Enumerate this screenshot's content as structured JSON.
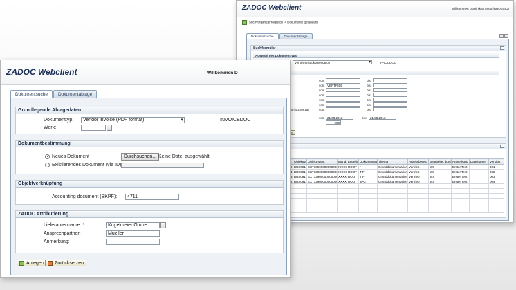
{
  "back": {
    "title": "ZADOC Webclient",
    "welcome": "Willkommen Dominik Brossio (BROSSIO)",
    "status_message": "Suchvorgang erfolgreich (4 Dokumente gefunden)",
    "tabs": [
      "Dokumentsuche",
      "Dokumentablage"
    ],
    "suchformular": {
      "header": "Suchformular",
      "auswahl_header": "Auswahl des Dokumenttyps",
      "doctype_label": "Dokumenttyp:",
      "doctype_value": "Verfahrensdokumentation",
      "doctype_code": "PROCDOC",
      "criteria_header": "Suchkriterien",
      "criteria": [
        {
          "label": "Thema",
          "from": "",
          "to": ""
        },
        {
          "label": "Arbeitsbereich",
          "from": "VERTRIEB",
          "to": ""
        },
        {
          "label": "Bearbeitet durch",
          "from": "",
          "to": ""
        },
        {
          "label": "Anmerkung",
          "from": "",
          "to": ""
        },
        {
          "label": "Dateiname",
          "from": "",
          "to": ""
        },
        {
          "label": "Version",
          "from": "",
          "to": ""
        },
        {
          "label": "External Document (BUS0915)",
          "from": "",
          "to": ""
        }
      ],
      "von_label": "von:",
      "bis_label": "bis:",
      "ablagedatum_label": "Ablagedatum",
      "ablagedatum_from": "21.08.2012",
      "ablagedatum_to": "21.08.2013",
      "max_treffer_label": "Max. Treffer",
      "max_treffer_value": "200",
      "search_button": "Suchen",
      "reset_button": "Zurücksetzen"
    },
    "results": {
      "header": "Gefundene Dokumente",
      "download_button": "Download",
      "columns": [
        "Ablagedatum",
        "Log Zeit",
        "Objekttyp",
        "Objekt-Ident",
        "Mand.",
        "Ersteller",
        "Dokumenttyp",
        "Thema",
        "Arbeitsbereich",
        "Bearbeitet durch",
        "Anmerkung",
        "Dateiname",
        "Version"
      ],
      "rows": [
        [
          "02.04.2013",
          "19:54:32",
          "BUS0915",
          "EXT1390000000000000",
          "XXXX",
          "ROOT",
          "*",
          "Grunddokumentation",
          "Vertrieb",
          "WS",
          "Erster Test",
          "",
          "001"
        ],
        [
          "02.04.2013",
          "19:55:44",
          "BUS0915",
          "EXT1390000000000000",
          "XXXX",
          "ROOT",
          "TIF",
          "Grunddokumentation",
          "Vertrieb",
          "WS",
          "Erster Test",
          "",
          "002"
        ],
        [
          "02.04.2013",
          "19:58:23",
          "BUS0915",
          "EXT1390000000000000",
          "XXXX",
          "ROOT",
          "TIF",
          "Grunddokumentation",
          "Vertrieb",
          "WS",
          "Erster Test",
          "",
          "003"
        ],
        [
          "02.04.2013",
          "19:58:52",
          "BUS0915",
          "EXT1390000000000000",
          "XXXX",
          "ROOT",
          "JPG",
          "Grunddokumentation",
          "Vertrieb",
          "WS",
          "Erster Test",
          "",
          "004"
        ]
      ]
    }
  },
  "front": {
    "title": "ZADOC Webclient",
    "welcome": "Willkommen D",
    "tabs": [
      "Dokumentsuche",
      "Dokumentablage"
    ],
    "grund": {
      "header": "Grundlegende Ablagedaten",
      "doctype_label": "Dokumenttyp:",
      "doctype_value": "Vendor invoice (PDF format)",
      "doctype_code": "INVOICEDOC",
      "werk_label": "Werk:",
      "werk_value": ""
    },
    "dokument": {
      "header": "Dokumentbestimmung",
      "option_new": "Neues Dokument",
      "option_existing": "Existierendes Dokument (via ID)",
      "browse_button": "Durchsuchen...",
      "no_file": "Keine Datei ausgewählt.",
      "id_value": ""
    },
    "objekt": {
      "header": "Objektverknüpfung",
      "accounting_label": "Accounting document (BKPF):",
      "accounting_value": "4711"
    },
    "attribut": {
      "header": "ZADOC Attributierung",
      "lieferant_label": "Lieferantenname:",
      "required_mark": "*",
      "lieferant_value": "Kugelmeier GmbH",
      "partner_label": "Ansprechpartner:",
      "partner_value": "Mueller",
      "anmerkung_label": "Anmerkung:",
      "anmerkung_value": ""
    },
    "buttons": {
      "ablegen": "Ablegen",
      "reset": "Zurücksetzen"
    }
  }
}
